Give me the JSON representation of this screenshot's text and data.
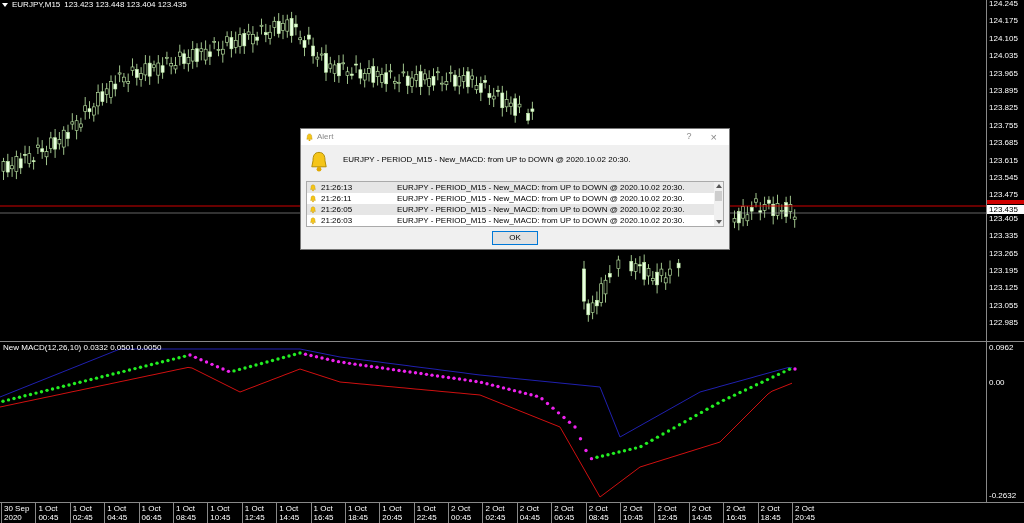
{
  "chart": {
    "symbol": "EURJPY,M15",
    "ohlc": "123.423 123.448 123.404 123.435",
    "price_ticks": [
      "124.245",
      "124.175",
      "124.105",
      "124.035",
      "123.965",
      "123.895",
      "123.825",
      "123.755",
      "123.685",
      "123.615",
      "123.545",
      "123.475",
      "123.405",
      "123.335",
      "123.265",
      "123.195",
      "123.125",
      "123.055",
      "122.985"
    ],
    "current_price": "123.435"
  },
  "indicator": {
    "label": "New MACD(12,26,10) 0.0332 0.0501 0.0050",
    "ticks": [
      "0.0962",
      "0.00",
      "-0.2632"
    ]
  },
  "time_axis": [
    "30 Sep 2020",
    "1 Oct 00:45",
    "1 Oct 02:45",
    "1 Oct 04:45",
    "1 Oct 06:45",
    "1 Oct 08:45",
    "1 Oct 10:45",
    "1 Oct 12:45",
    "1 Oct 14:45",
    "1 Oct 16:45",
    "1 Oct 18:45",
    "1 Oct 20:45",
    "1 Oct 22:45",
    "2 Oct 00:45",
    "2 Oct 02:45",
    "2 Oct 04:45",
    "2 Oct 06:45",
    "2 Oct 08:45",
    "2 Oct 10:45",
    "2 Oct 12:45",
    "2 Oct 14:45",
    "2 Oct 16:45",
    "2 Oct 18:45",
    "2 Oct 20:45"
  ],
  "dialog": {
    "title": "Alert",
    "help": "?",
    "close": "×",
    "message": "EURJPY - PERIOD_M15 - New_MACD: from UP to DOWN @ 2020.10.02 20:30.",
    "rows": [
      {
        "time": "21:26:13",
        "text": "EURJPY - PERIOD_M15 - New_MACD: from UP to DOWN @ 2020.10.02 20:30.",
        "selected": true
      },
      {
        "time": "21:26:11",
        "text": "EURJPY - PERIOD_M15 - New_MACD: from UP to DOWN @ 2020.10.02 20:30.",
        "selected": false
      },
      {
        "time": "21:26:05",
        "text": "EURJPY - PERIOD_M15 - New_MACD: from UP to DOWN @ 2020.10.02 20:30.",
        "selected": true
      },
      {
        "time": "21:26:03",
        "text": "EURJPY - PERIOD_M15 - New_MACD: from UP to DOWN @ 2020.10.02 20:30.",
        "selected": false
      }
    ],
    "button": "OK"
  }
}
